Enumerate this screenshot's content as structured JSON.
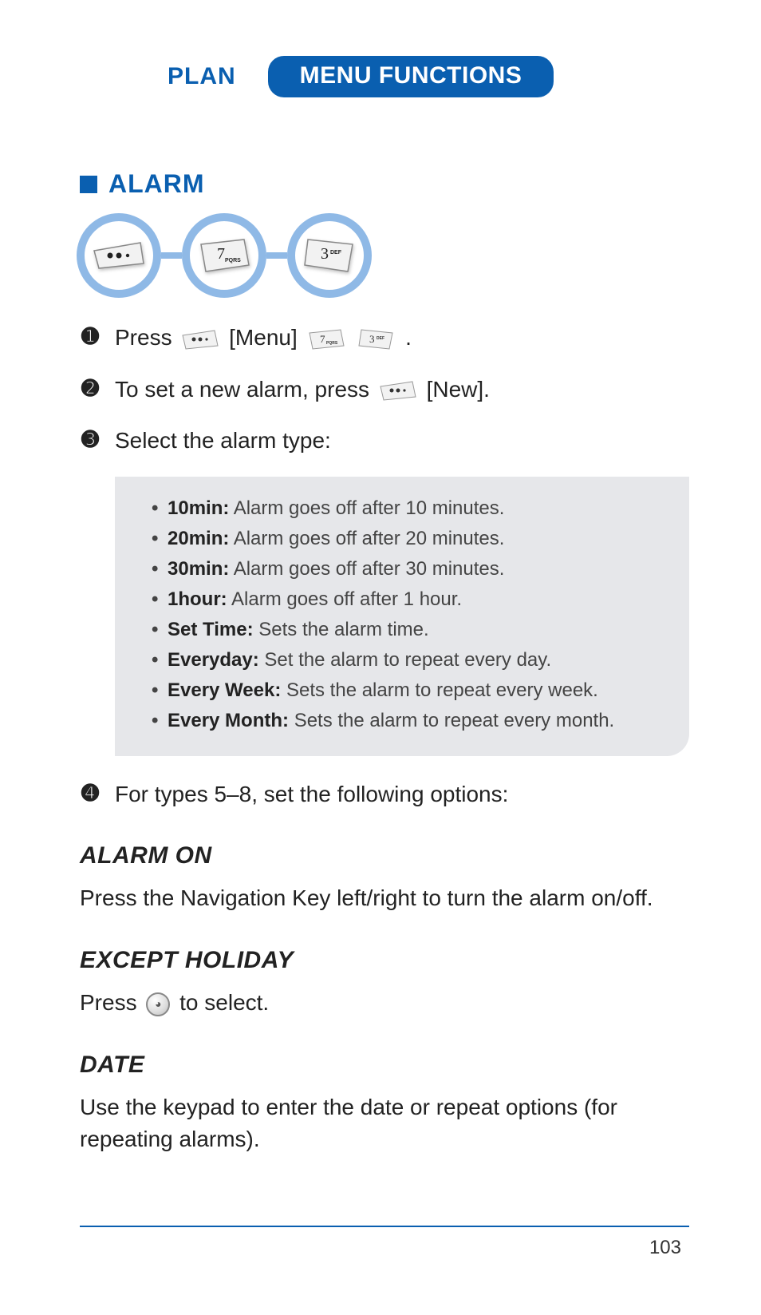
{
  "header": {
    "plan": "PLAN",
    "menu_functions": "MENU FUNCTIONS"
  },
  "section_title": "ALARM",
  "key_sequence": [
    {
      "glyph": "dots"
    },
    {
      "glyph": "7",
      "sub": "PQRS"
    },
    {
      "glyph": "3",
      "sub": "DEF"
    }
  ],
  "steps": {
    "s1": {
      "num": "➊",
      "pre": "Press ",
      "mid": " [Menu] ",
      "post": " ."
    },
    "s2": {
      "num": "➋",
      "pre": "To set a new alarm, press ",
      "post": " [New]."
    },
    "s3": {
      "num": "➌",
      "text": "Select the alarm type:"
    },
    "s4": {
      "num": "➍",
      "text": "For types 5–8, set the following options:"
    }
  },
  "alarm_types": [
    {
      "label": "10min:",
      "desc": "Alarm goes off after 10 minutes."
    },
    {
      "label": "20min:",
      "desc": "Alarm goes off after 20 minutes."
    },
    {
      "label": "30min:",
      "desc": "Alarm goes off after 30 minutes."
    },
    {
      "label": "1hour:",
      "desc": "Alarm goes off after 1 hour."
    },
    {
      "label": "Set Time:",
      "desc": "Sets the alarm time."
    },
    {
      "label": "Everyday:",
      "desc": "Set the alarm to repeat every day."
    },
    {
      "label": "Every Week:",
      "desc": "Sets the alarm to repeat every week."
    },
    {
      "label": "Every Month:",
      "desc": "Sets the alarm to repeat every month."
    }
  ],
  "sections": {
    "alarm_on": {
      "heading": "ALARM ON",
      "body": "Press the Navigation Key left/right to turn the alarm on/off."
    },
    "except_holiday": {
      "heading": "EXCEPT HOLIDAY",
      "body_pre": "Press ",
      "body_post": " to select."
    },
    "date": {
      "heading": "DATE",
      "body": "Use the keypad to enter the date or repeat options (for repeating alarms)."
    }
  },
  "page_number": "103"
}
